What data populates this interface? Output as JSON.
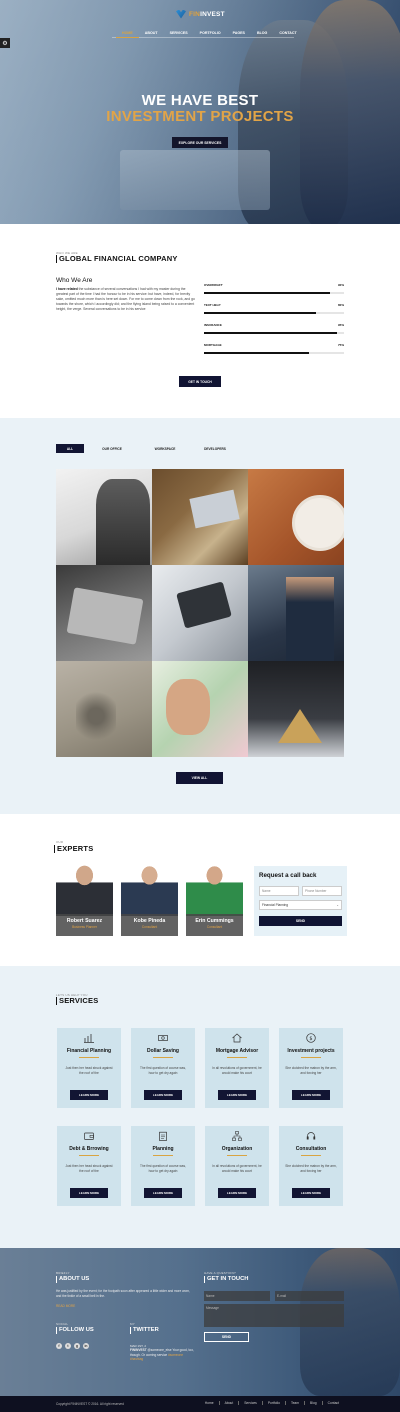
{
  "brand": {
    "prefix": "FIN",
    "name": "INVEST"
  },
  "nav": [
    "HOME",
    "ABOUT",
    "SERVICES",
    "PORTFOLIO",
    "PAGES",
    "BLOG",
    "CONTACT"
  ],
  "hero": {
    "line1": "WE HAVE BEST",
    "line2": "INVESTMENT PROJECTS",
    "button": "EXPLORE OUR SERVICES"
  },
  "about": {
    "sub": "WHO WE ARE",
    "title": "GLOBAL FINANCIAL COMPANY",
    "heading": "Who We Are",
    "lead": "I have related",
    "text": " the substance of several conversations I had with my master during the greatest part of the time I had the honour to be in his service: but have, indeed, for brevity sake, omitted much more than is here set down. For me to come down from the rock, and go towards the shore, which I accordingly did; and the flying island being raised to a convenient height, the verge. Several conversations to be in his service",
    "skills": [
      {
        "name": "OVERDRAFT",
        "pct": "90%",
        "value": 90
      },
      {
        "name": "TEXT HELP",
        "pct": "80%",
        "value": 80
      },
      {
        "name": "INSURANCE",
        "pct": "95%",
        "value": 95
      },
      {
        "name": "MORTGAGE",
        "pct": "75%",
        "value": 75
      }
    ],
    "button": "GET IN TOUCH"
  },
  "portfolio": {
    "tabs": [
      "ALL",
      "OUR OFFICE",
      "WORKSPACE",
      "DEVELOPERS"
    ],
    "button": "VIEW ALL"
  },
  "experts": {
    "sub": "OUR",
    "title": "EXPERTS",
    "people": [
      {
        "name": "Robert Suarez",
        "role": "Business Planner"
      },
      {
        "name": "Kobe Pineda",
        "role": "Consultant"
      },
      {
        "name": "Erin Cummings",
        "role": "Consultant"
      }
    ]
  },
  "callback": {
    "title": "Request a call back",
    "name_ph": "Name",
    "phone_ph": "Phone Number",
    "select": "Financial Planning",
    "button": "SEND"
  },
  "services": {
    "sub": "LETS US HELP YOU",
    "title": "SERVICES",
    "items": [
      {
        "title": "Financial Planning",
        "desc": "Just then her head struck against the roof of the",
        "button": "LEARN MORE",
        "icon": "chart-icon"
      },
      {
        "title": "Dollar Saving",
        "desc": "The first question of course was, how to get dry again",
        "button": "LEARN MORE",
        "icon": "dollar-icon"
      },
      {
        "title": "Mortgage Advisor",
        "desc": "In all revolutions of government, he would make his court",
        "button": "LEARN MORE",
        "icon": "house-icon"
      },
      {
        "title": "Investment projects",
        "desc": "She clutched the matron by the arm, and forcing her",
        "button": "LEARN MORE",
        "icon": "coin-icon"
      },
      {
        "title": "Debt & Brrowing",
        "desc": "Just then her head struck against the roof of the",
        "button": "LEARN MORE",
        "icon": "wallet-icon"
      },
      {
        "title": "Planning",
        "desc": "The first question of course was, how to get dry again",
        "button": "LEARN MORE",
        "icon": "clipboard-icon"
      },
      {
        "title": "Organization",
        "desc": "In all revolutions of government, he would make his court",
        "button": "LEARN MORE",
        "icon": "org-icon"
      },
      {
        "title": "Consultation",
        "desc": "She clutched the matron by the arm, and forcing her",
        "button": "LEARN MORE",
        "icon": "headset-icon"
      }
    ]
  },
  "footer": {
    "about_sub": "BRIEFLY",
    "about_title": "ABOUT US",
    "about_text": "He was justified by the event; for the footpath soon after appeared a little wider and more worn, and the tinkle of a small bell in the.",
    "read_more": "READ MORE",
    "follow_sub": "SOCIAL",
    "follow_title": "FOLLOW US",
    "social": [
      "f",
      "t",
      "g",
      "in"
    ],
    "twitter_sub": "MY",
    "twitter_title": "TWITTER",
    "tweet_user": "FININVEST",
    "tweet_handle": "@someone_else",
    "tweet_text": "Your good, too, though. Or coming service",
    "tweet_link": "#someone #hashtag",
    "tweet_time": "MAR 1ST, 2",
    "touch_sub": "HAVE A QUESTION?",
    "touch_title": "GET IN TOUCH",
    "name_ph": "Name",
    "email_ph": "E-mail",
    "message_ph": "Message",
    "send": "SEND"
  },
  "bottom": {
    "copyright": "Copyright FININVEST © 2016. All right reserved",
    "links": [
      "Home",
      "About",
      "Services",
      "Portfolio",
      "Team",
      "Blog",
      "Contact"
    ]
  },
  "colors": {
    "navy": "#121533",
    "gold": "#e2a447",
    "light": "#eaf2f7"
  }
}
